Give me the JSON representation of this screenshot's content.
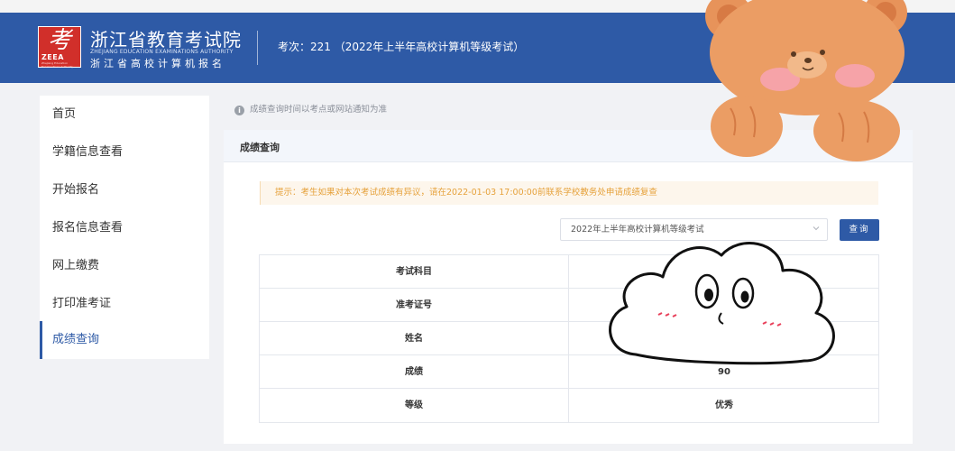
{
  "header": {
    "logo_glyph": "考",
    "logo_abbr": "ZEEA",
    "logo_tiny": "Zhejiang Education Examinations Authority",
    "org_title": "浙江省教育考试院",
    "org_en": "ZHEJIANG EDUCATION EXAMINATIONS AUTHORITY",
    "org_sub": "浙江省高校计算机报名",
    "exam_info": "考次：221 （2022年上半年高校计算机等级考试）"
  },
  "sidebar": {
    "items": [
      {
        "label": "首页"
      },
      {
        "label": "学籍信息查看"
      },
      {
        "label": "开始报名"
      },
      {
        "label": "报名信息查看"
      },
      {
        "label": "网上缴费"
      },
      {
        "label": "打印准考证"
      },
      {
        "label": "成绩查询"
      }
    ]
  },
  "notice": "成绩查询时间以考点或网站通知为准",
  "panel": {
    "title": "成绩查询",
    "tip": "提示：考生如果对本次考试成绩有异议，请在2022-01-03 17:00:00前联系学校教务处申请成绩复查",
    "select_value": "2022年上半年高校计算机等级考试",
    "query_label": "查询"
  },
  "table": {
    "rows": [
      {
        "key": "考试科目",
        "value": ""
      },
      {
        "key": "准考证号",
        "value": ""
      },
      {
        "key": "姓名",
        "value": ""
      },
      {
        "key": "成绩",
        "value": "90"
      },
      {
        "key": "等级",
        "value": "优秀"
      }
    ]
  },
  "colors": {
    "header": "#2e5aa6",
    "logo_red": "#d12f2a",
    "tip_text": "#e6a23c",
    "tip_bg": "#fdf6ec",
    "accent": "#2e5aa6"
  },
  "icons": [
    "info-icon",
    "chevron-down-icon",
    "bear-sticker",
    "cloud-sticker"
  ]
}
